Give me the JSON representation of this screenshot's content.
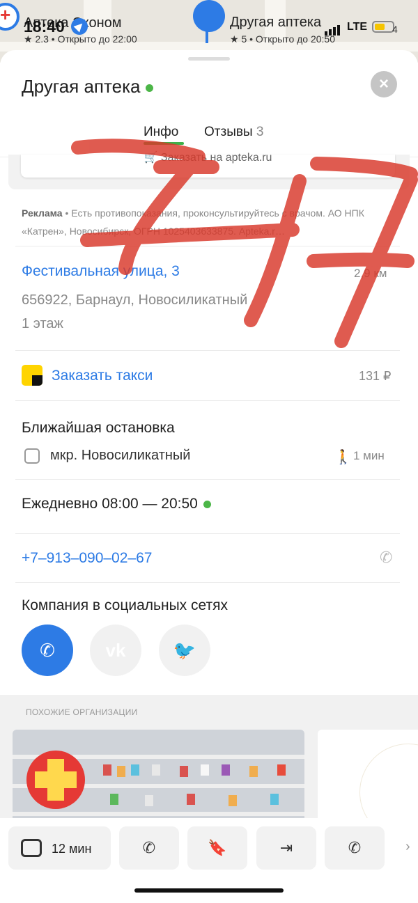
{
  "status": {
    "time": "18:40",
    "network": "LTE",
    "battery": "4"
  },
  "map": {
    "left_pharmacy": {
      "name": "Аптека Эконом",
      "rating": "★ 2.3 • Открыто до 22:00"
    },
    "right_pharmacy": {
      "name": "Другая аптека",
      "rating": "★ 5 • Открыто до 20:50"
    }
  },
  "sheet": {
    "title": "Другая аптека",
    "tabs": [
      {
        "label": "Инфо",
        "count": ""
      },
      {
        "label": "Отзывы",
        "count": "3"
      }
    ],
    "order_label": "Заказать на apteka.ru",
    "ad_label": "Реклама",
    "ad_text": "• Есть противопоказания, проконсультируйтесь с врачом. АО НПК «Катрен», Новосибирск, ОГРН 1025403633875. Apteka.r…",
    "address": "Фестивальная улица, 3",
    "distance": "2,9 км",
    "address_city": "656922, Барнаул, Новосиликатный",
    "floor": "1 этаж",
    "taxi_label": "Заказать такси",
    "taxi_price": "131 ₽",
    "stop_heading": "Ближайшая остановка",
    "stop_name": "мкр. Новосиликатный",
    "walk_time": "1 мин",
    "hours": "Ежедневно 08:00 — 20:50",
    "phone": "+7‒913‒090‒02‒67",
    "social_heading": "Компания в социальных сетях",
    "similar_heading": "ПОХОЖИЕ ОРГАНИЗАЦИИ",
    "route_time": "12 мин"
  },
  "colors": {
    "accent": "#2d7be5",
    "open_dot": "#4cb648",
    "scribble": "#d9382a"
  }
}
